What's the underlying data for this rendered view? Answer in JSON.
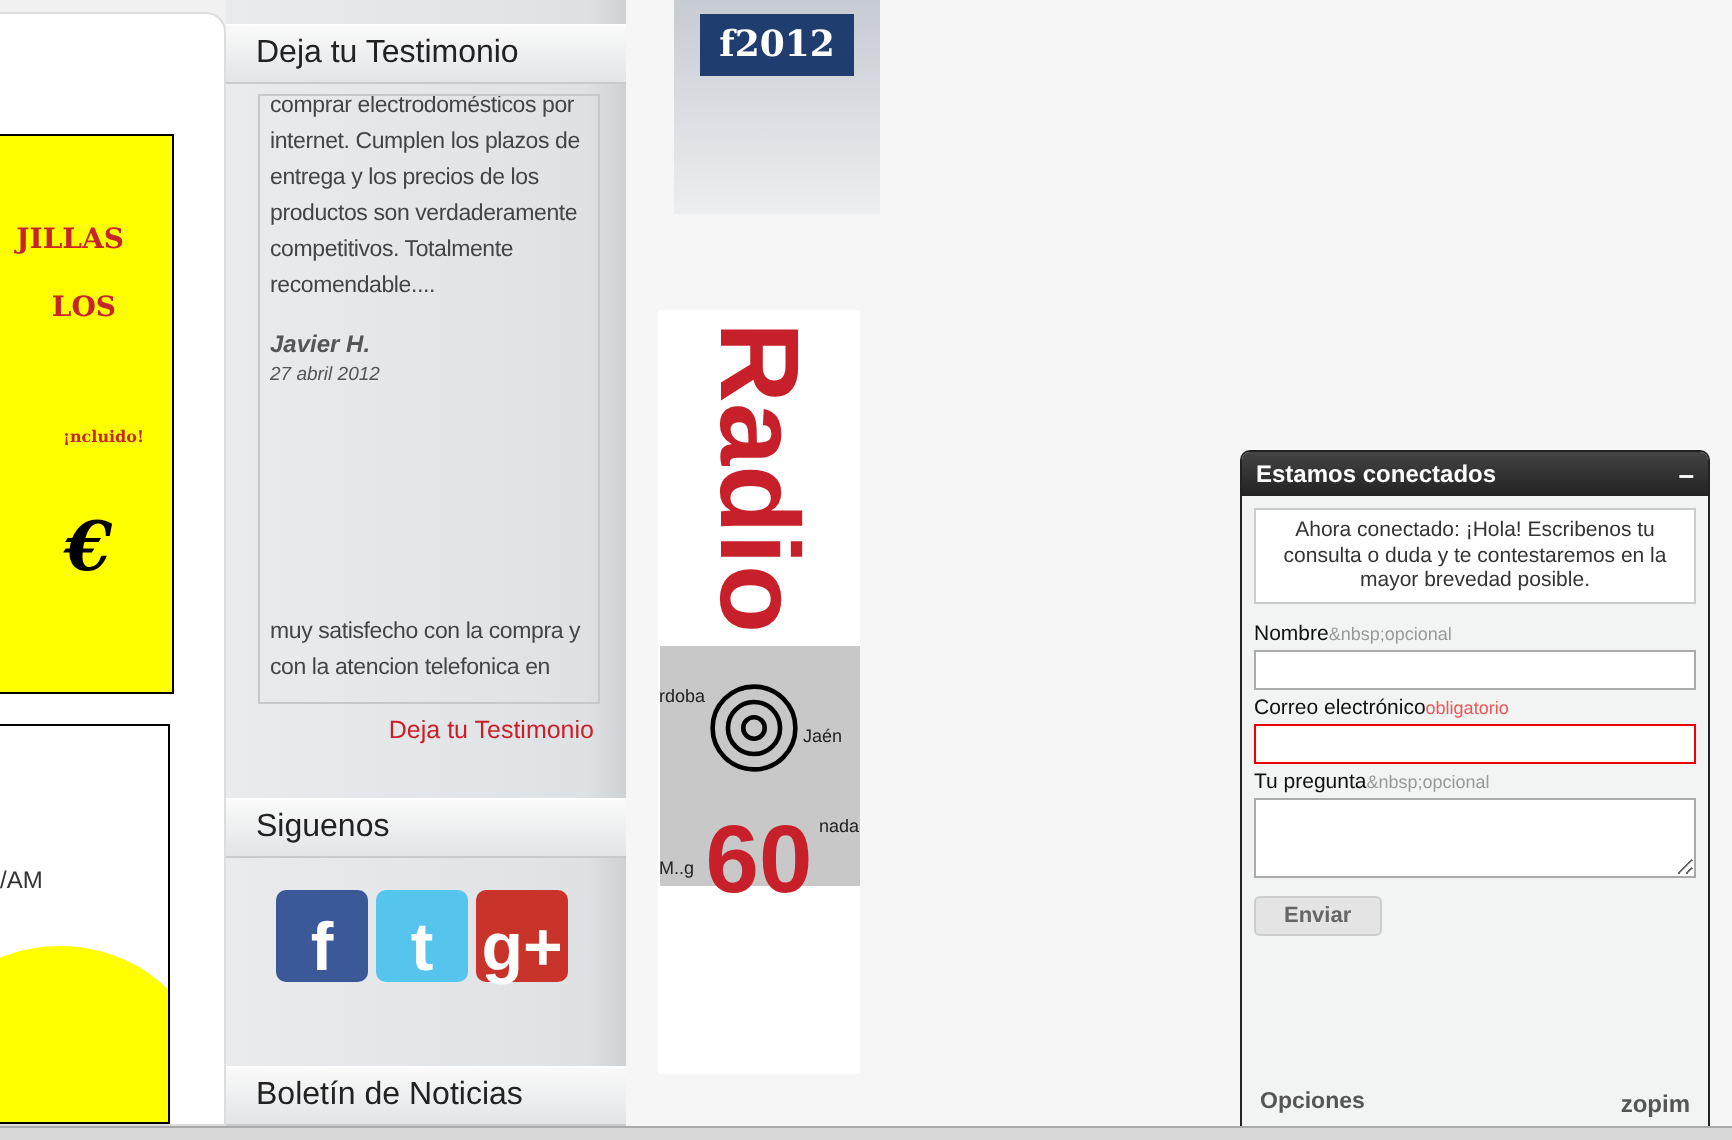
{
  "banners_left": [
    {
      "kind": "promo",
      "texts": [
        "JILLAS",
        "LOS",
        "¡ncluido!",
        "€"
      ]
    },
    {
      "kind": "info",
      "texts": [
        "/AM"
      ]
    }
  ],
  "sidebar": {
    "testimonials": {
      "title": "Deja tu Testimonio",
      "entries": [
        {
          "text": "comprar electrodomésticos por internet. Cumplen los plazos de entrega y los precios de los productos son verdaderamente competitivos. Totalmente recomendable....",
          "author": "Javier H.",
          "date": "27 abril 2012"
        },
        {
          "text": "muy satisfecho con la compra y con la atencion telefonica en"
        }
      ],
      "link": "Deja tu Testimonio"
    },
    "social": {
      "title": "Siguenos",
      "icons": [
        {
          "kind": "facebook",
          "label": "f"
        },
        {
          "kind": "twitter",
          "label": "t"
        },
        {
          "kind": "googleplus",
          "label": "g+"
        }
      ]
    },
    "newsletter": {
      "title": "Boletín de Noticias"
    }
  },
  "ads": [
    {
      "kind": "badge",
      "label": "f2012"
    },
    {
      "kind": "radio",
      "word": "Radio",
      "number": "60",
      "places": [
        "rdoba",
        "Jaén",
        "nada",
        "M..g"
      ]
    }
  ],
  "chat": {
    "title": "Estamos conectados",
    "minimize": "–",
    "greeting": "Ahora conectado: ¡Hola! Escribenos tu consulta o duda y te contestaremos en la mayor brevedad posible.",
    "fields": [
      {
        "label": "Nombre",
        "hint": "&nbsp;opcional",
        "required": false,
        "kind": "input"
      },
      {
        "label": "Correo electrónico",
        "hint": "obligatorio",
        "required": true,
        "kind": "input"
      },
      {
        "label": "Tu pregunta",
        "hint": "&nbsp;opcional",
        "required": false,
        "kind": "textarea"
      }
    ],
    "submit": "Enviar",
    "options": "Opciones",
    "brand": "zopim"
  }
}
